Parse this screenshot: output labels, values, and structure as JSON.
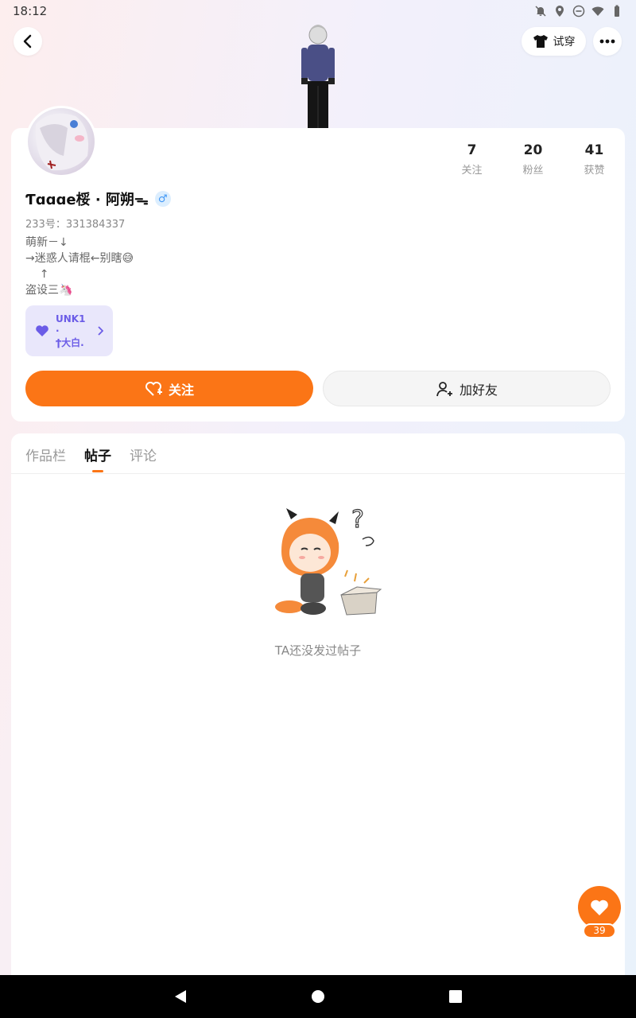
{
  "status_bar": {
    "time": "18:12"
  },
  "header": {
    "tryon_label": "试穿"
  },
  "profile": {
    "username": "Ƭɑɑɑe桵 · 阿朔ᯓ",
    "gender_symbol": "♂",
    "uid": "233号：331384337",
    "bio": "萌新－↓\n→迷惑人请棍←别瞎😅\n    ↑\n盗设三🦄",
    "stats": [
      {
        "value": "7",
        "label": "关注"
      },
      {
        "value": "20",
        "label": "粉丝"
      },
      {
        "value": "41",
        "label": "获赞"
      }
    ],
    "team_chip": {
      "line1": "UNK1",
      "line2": "·",
      "line3": "ϯ大白."
    }
  },
  "actions": {
    "follow_label": "关注",
    "add_friend_label": "加好友"
  },
  "tabs": [
    {
      "label": "作品栏",
      "active": false
    },
    {
      "label": "帖子",
      "active": true
    },
    {
      "label": "评论",
      "active": false
    }
  ],
  "empty_state": {
    "text": "TA还没发过帖子"
  },
  "like_fab": {
    "count": "39"
  },
  "colors": {
    "accent": "#fb7516",
    "chip_bg": "#e9e7fb",
    "chip_text": "#6b5ce7",
    "gender": "#3f96f5"
  }
}
